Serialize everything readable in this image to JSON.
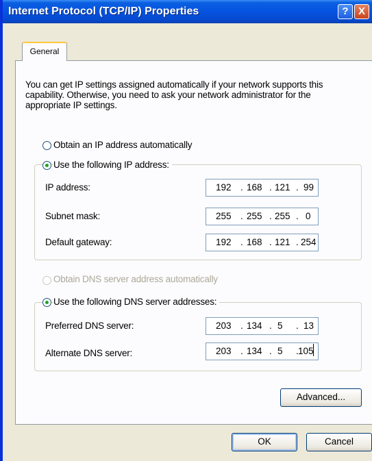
{
  "window": {
    "title": "Internet Protocol (TCP/IP) Properties",
    "help_glyph": "?",
    "close_glyph": "X"
  },
  "tabs": [
    {
      "label": "General",
      "selected": true
    }
  ],
  "description": "You can get IP settings assigned automatically if your network supports this capability. Otherwise, you need to ask your network administrator for the appropriate IP settings.",
  "ip_mode": {
    "auto_label": "Obtain an IP address automatically",
    "manual_label": "Use the following IP address:",
    "selected": "manual"
  },
  "ip_fields": {
    "ip_address": {
      "label": "IP address:",
      "octets": [
        "192",
        "168",
        "121",
        "99"
      ]
    },
    "subnet_mask": {
      "label": "Subnet mask:",
      "octets": [
        "255",
        "255",
        "255",
        "0"
      ]
    },
    "default_gateway": {
      "label": "Default gateway:",
      "octets": [
        "192",
        "168",
        "121",
        "254"
      ]
    }
  },
  "dns_mode": {
    "auto_label": "Obtain DNS server address automatically",
    "manual_label": "Use the following DNS server addresses:",
    "selected": "manual",
    "auto_enabled": false
  },
  "dns_fields": {
    "preferred": {
      "label": "Preferred DNS server:",
      "octets": [
        "203",
        "134",
        "5",
        "13"
      ]
    },
    "alternate": {
      "label": "Alternate DNS server:",
      "octets": [
        "203",
        "134",
        "5",
        "105"
      ]
    }
  },
  "buttons": {
    "advanced": "Advanced...",
    "ok": "OK",
    "cancel": "Cancel"
  },
  "colors": {
    "titlebar": "#0553e0",
    "dialog_bg": "#ece9d8",
    "panel_bg": "#fcfcfe",
    "tab_highlight": "#ffc83c",
    "radio_dot": "#21a121",
    "close_button": "#c8451d"
  }
}
